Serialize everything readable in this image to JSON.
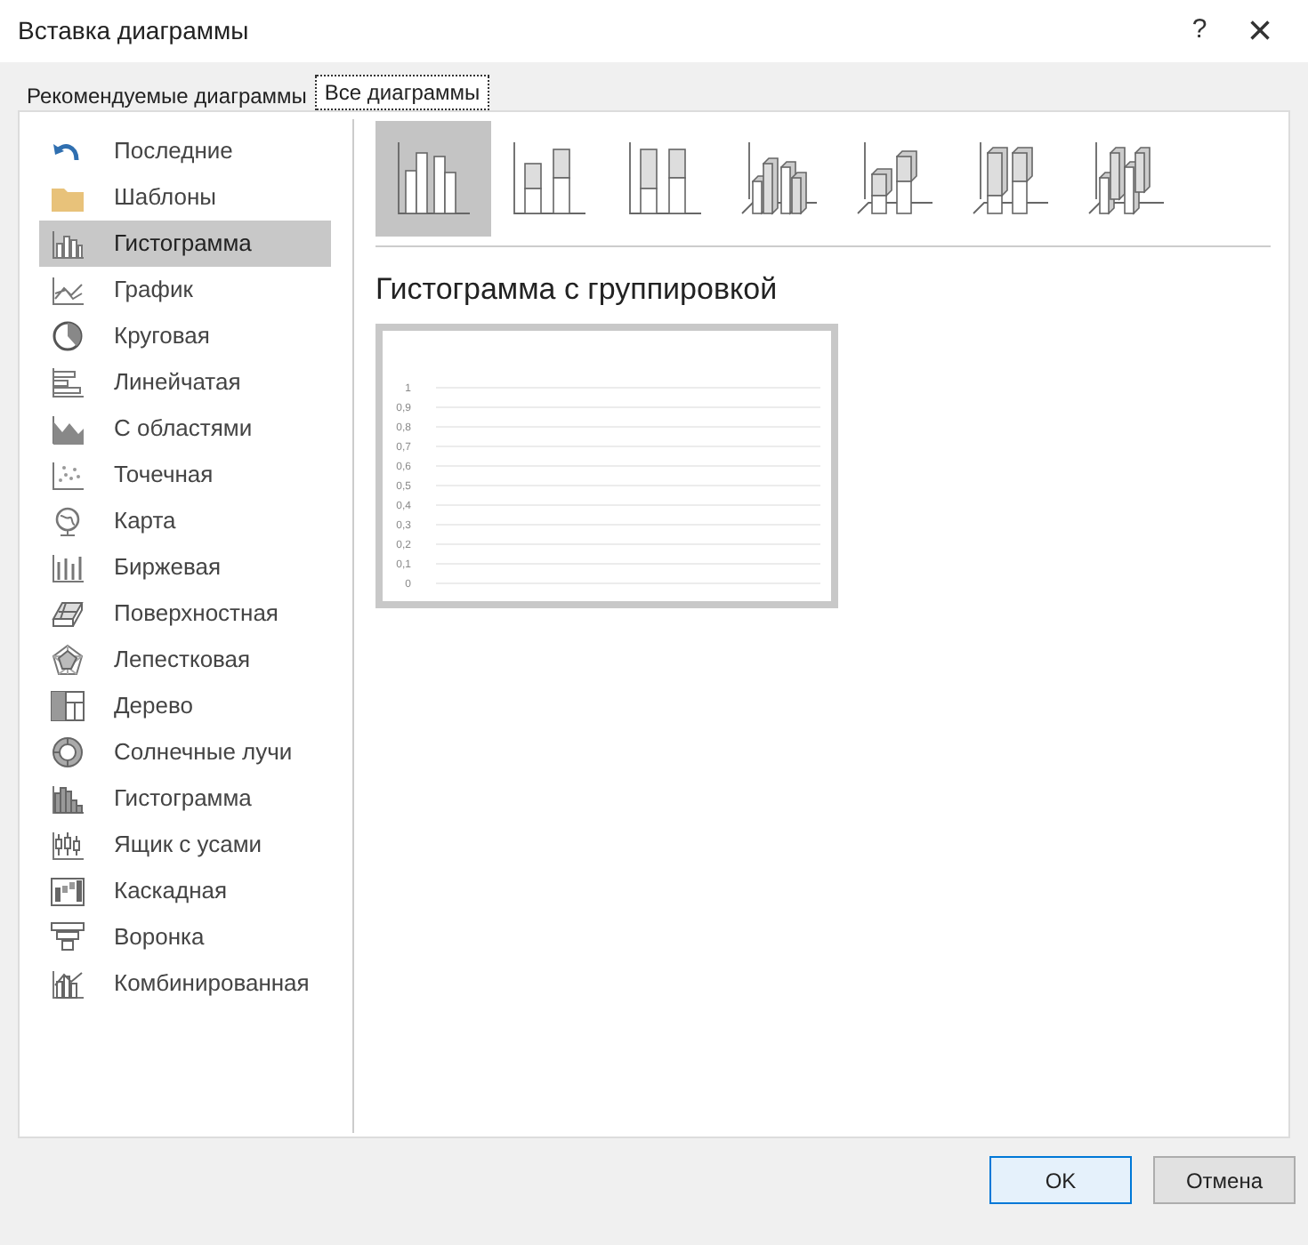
{
  "window": {
    "title": "Вставка диаграммы",
    "help": "?",
    "close": "×"
  },
  "tabs": [
    {
      "label": "Рекомендуемые диаграммы",
      "selected": false
    },
    {
      "label": "Все диаграммы",
      "selected": true
    }
  ],
  "sidebar": {
    "items": [
      {
        "label": "Последние",
        "kind": "recent",
        "selected": false
      },
      {
        "label": "Шаблоны",
        "kind": "templates",
        "selected": false
      },
      {
        "label": "Гистограмма",
        "kind": "column",
        "selected": true
      },
      {
        "label": "График",
        "kind": "line",
        "selected": false
      },
      {
        "label": "Круговая",
        "kind": "pie",
        "selected": false
      },
      {
        "label": "Линейчатая",
        "kind": "bar",
        "selected": false
      },
      {
        "label": "С областями",
        "kind": "area",
        "selected": false
      },
      {
        "label": "Точечная",
        "kind": "scatter",
        "selected": false
      },
      {
        "label": "Карта",
        "kind": "map",
        "selected": false
      },
      {
        "label": "Биржевая",
        "kind": "stock",
        "selected": false
      },
      {
        "label": "Поверхностная",
        "kind": "surface",
        "selected": false
      },
      {
        "label": "Лепестковая",
        "kind": "radar",
        "selected": false
      },
      {
        "label": "Дерево",
        "kind": "treemap",
        "selected": false
      },
      {
        "label": "Солнечные лучи",
        "kind": "sunburst",
        "selected": false
      },
      {
        "label": "Гистограмма",
        "kind": "histogram",
        "selected": false
      },
      {
        "label": "Ящик с усами",
        "kind": "box",
        "selected": false
      },
      {
        "label": "Каскадная",
        "kind": "waterfall",
        "selected": false
      },
      {
        "label": "Воронка",
        "kind": "funnel",
        "selected": false
      },
      {
        "label": "Комбинированная",
        "kind": "combo",
        "selected": false
      }
    ]
  },
  "subtypes": [
    {
      "kind": "clustered",
      "selected": true
    },
    {
      "kind": "stacked",
      "selected": false
    },
    {
      "kind": "stacked100",
      "selected": false
    },
    {
      "kind": "clustered3d",
      "selected": false
    },
    {
      "kind": "stacked3d",
      "selected": false
    },
    {
      "kind": "stacked100_3d",
      "selected": false
    },
    {
      "kind": "column3d",
      "selected": false
    }
  ],
  "preview": {
    "title": "Гистограмма с группировкой",
    "axis_labels": [
      "1",
      "0,9",
      "0,8",
      "0,7",
      "0,6",
      "0,5",
      "0,4",
      "0,3",
      "0,2",
      "0,1",
      "0"
    ]
  },
  "buttons": [
    {
      "label": "OK",
      "kind": "primary"
    },
    {
      "label": "Отмена",
      "kind": "secondary"
    }
  ]
}
